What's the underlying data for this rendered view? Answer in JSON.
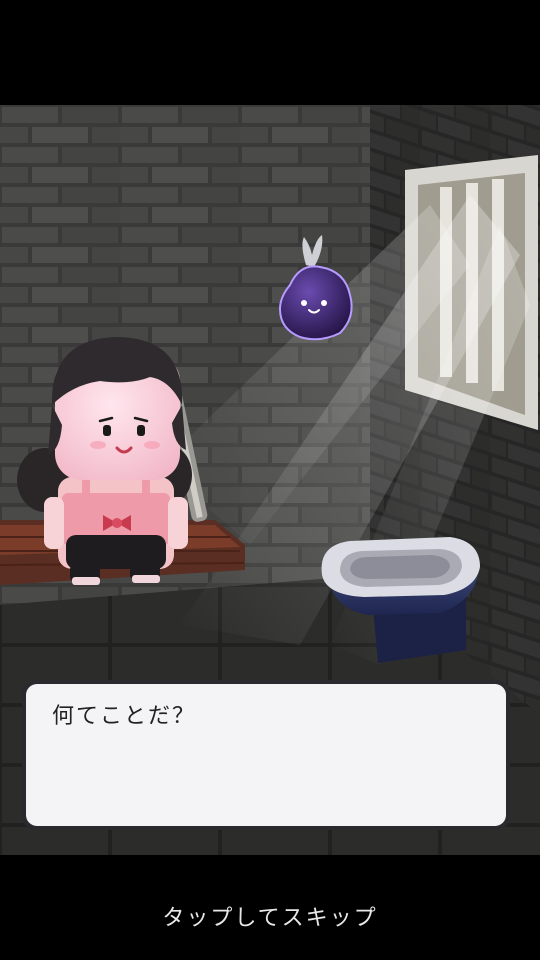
{
  "dialog": {
    "text": "何てことだ？"
  },
  "skip": {
    "label": "タップしてスキップ"
  }
}
